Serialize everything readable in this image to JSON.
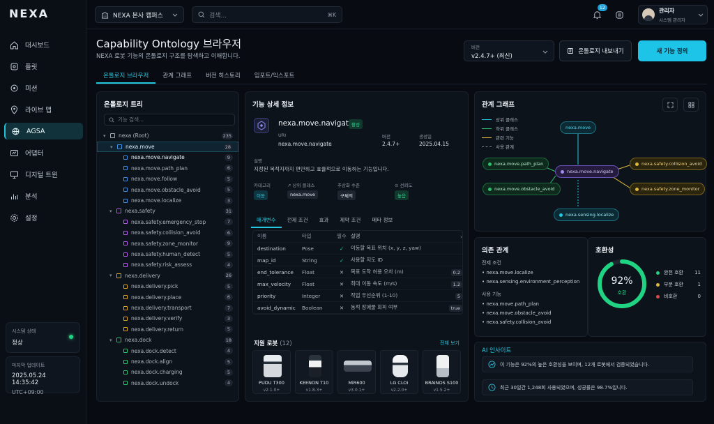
{
  "brand": {
    "logo": "NEXA"
  },
  "sidebar": {
    "items": [
      {
        "label": "대시보드",
        "icon": "home-icon"
      },
      {
        "label": "플릿",
        "icon": "fleet-icon"
      },
      {
        "label": "미션",
        "icon": "mission-icon"
      },
      {
        "label": "라이브 맵",
        "icon": "map-icon"
      },
      {
        "label": "AGSA",
        "icon": "agsa-icon",
        "active": true
      },
      {
        "label": "어댑터",
        "icon": "adapter-icon"
      },
      {
        "label": "디지털 트윈",
        "icon": "twin-icon"
      },
      {
        "label": "분석",
        "icon": "analytics-icon"
      },
      {
        "label": "설정",
        "icon": "settings-icon"
      }
    ],
    "system_status_label": "시스템 상태",
    "system_status_value": "정상",
    "last_update_label": "마지막 업데이트",
    "last_update_value": "2025.05.24 14:35:42",
    "timezone": "UTC+09:00"
  },
  "topbar": {
    "campus": "NEXA 본사 캠퍼스",
    "search_placeholder": "검색...",
    "search_shortcut": "⌘K",
    "notifications_count": "12",
    "user_name": "관리자",
    "user_role": "시스템 관리자"
  },
  "page": {
    "title": "Capability Ontology 브라우저",
    "subtitle": "NEXA 로봇 기능의 온톨로지 구조를 탐색하고 이해합니다.",
    "version_label": "버전",
    "version_value": "v2.4.7+ (최신)",
    "export_label": "온톨로지 내보내기",
    "new_label": "새 기능 정의",
    "tabs": [
      "온톨로지 브라우저",
      "관계 그래프",
      "버전 히스토리",
      "임포트/익스포트"
    ]
  },
  "tree": {
    "title": "온톨로지 트리",
    "search_placeholder": "기능 검색...",
    "root": {
      "label": "nexa (Root)",
      "count": "235"
    },
    "groups": [
      {
        "label": "nexa.move",
        "count": "28",
        "color": "#3b8fe6",
        "children": [
          {
            "label": "nexa.move.navigate",
            "count": "9"
          },
          {
            "label": "nexa.move.path_plan",
            "count": "6"
          },
          {
            "label": "nexa.move.follow",
            "count": "5"
          },
          {
            "label": "nexa.move.obstacle_avoid",
            "count": "5"
          },
          {
            "label": "nexa.move.localize",
            "count": "3"
          }
        ]
      },
      {
        "label": "nexa.safety",
        "count": "31",
        "color": "#b05ce6",
        "children": [
          {
            "label": "nexa.safety.emergency_stop",
            "count": "7"
          },
          {
            "label": "nexa.safety.collision_avoid",
            "count": "6"
          },
          {
            "label": "nexa.safety.zone_monitor",
            "count": "9"
          },
          {
            "label": "nexa.safety.human_detect",
            "count": "5"
          },
          {
            "label": "nexa.safety.risk_assess",
            "count": "4"
          }
        ]
      },
      {
        "label": "nexa.delivery",
        "count": "26",
        "color": "#e0a52b",
        "children": [
          {
            "label": "nexa.delivery.pick",
            "count": "5"
          },
          {
            "label": "nexa.delivery.place",
            "count": "6"
          },
          {
            "label": "nexa.delivery.transport",
            "count": "7"
          },
          {
            "label": "nexa.delivery.verify",
            "count": "3"
          },
          {
            "label": "nexa.delivery.return",
            "count": "5"
          }
        ]
      },
      {
        "label": "nexa.dock",
        "count": "18",
        "color": "#2fbf6e",
        "children": [
          {
            "label": "nexa.dock.detect",
            "count": "4"
          },
          {
            "label": "nexa.dock.align",
            "count": "5"
          },
          {
            "label": "nexa.dock.charging",
            "count": "5"
          },
          {
            "label": "nexa.dock.undock",
            "count": "4"
          }
        ]
      }
    ]
  },
  "detail": {
    "title": "기능 상세 정보",
    "name": "nexa.move.navigate",
    "status": "활성",
    "uri_label": "URI",
    "uri_value": "nexa.move.navigate",
    "version_label": "버전",
    "version_value": "2.4.7+",
    "created_label": "생성일",
    "created_value": "2025.04.15",
    "desc_label": "설명",
    "desc_value": "지정된 목적지까지 편안하고 효율적으로 이동하는 기능입니다.",
    "category_label": "카테고리",
    "category_value": "이동",
    "parent_label": "↗ 상위 클래스",
    "parent_value": "nexa.move",
    "abstraction_label": "추상화 수준",
    "abstraction_value": "구체적",
    "maturity_label": "⊙ 선뢰도",
    "maturity_value": "높음",
    "subtabs": [
      "매개변수",
      "전제 조건",
      "효과",
      "제약 조건",
      "메타 정보"
    ],
    "param_headers": [
      "이름",
      "타입",
      "필수",
      "설명",
      "›"
    ],
    "params": [
      {
        "name": "destination",
        "type": "Pose",
        "req": "✓",
        "desc": "이동할 목표 위치 (x, y, z, yaw)",
        "def": ""
      },
      {
        "name": "map_id",
        "type": "String",
        "req": "✓",
        "desc": "사용할 지도 ID",
        "def": ""
      },
      {
        "name": "end_tolerance",
        "type": "Float",
        "req": "✕",
        "desc": "목표 도착 허용 오차 (m)",
        "def": "0.2"
      },
      {
        "name": "max_velocity",
        "type": "Float",
        "req": "✕",
        "desc": "최대 이동 속도 (m/s)",
        "def": "1.2"
      },
      {
        "name": "priority",
        "type": "Integer",
        "req": "✕",
        "desc": "작업 우선순위 (1-10)",
        "def": "5"
      },
      {
        "name": "avoid_dynamic",
        "type": "Boolean",
        "req": "✕",
        "desc": "동적 장애물 회피 여부",
        "def": "true"
      }
    ],
    "robots_title": "지원 로봇",
    "robots_count": "(12)",
    "robots_all": "전체 보기",
    "robots": [
      {
        "name": "PUDU T300",
        "ver": "v2.1.0+"
      },
      {
        "name": "KEENON T10",
        "ver": "v1.8.3+"
      },
      {
        "name": "MiR600",
        "ver": "v3.0.1+"
      },
      {
        "name": "LG CLOi",
        "ver": "v2.2.0+"
      },
      {
        "name": "BRAINOS S100",
        "ver": "v1.5.2+"
      }
    ]
  },
  "graph": {
    "title": "관계 그래프",
    "legend": [
      "상위 클래스",
      "하위 클래스",
      "관련 기능",
      "사용 관계"
    ],
    "nodes": {
      "parent": "nexa.move",
      "center": "nexa.move.navigate",
      "left1": "nexa.move.path_plan",
      "left2": "nexa.move.obstacle_avoid",
      "right1": "nexa.safety.collision_avoid",
      "right2": "nexa.safety.zone_monitor",
      "bottom": "nexa.sensing.localize"
    }
  },
  "deps": {
    "title": "의존 관계",
    "pre_label": "전제 조건",
    "pre_items": [
      "nexa.move.localize",
      "nexa.sensing.environment_perception"
    ],
    "used_label": "사용 기능",
    "used_items": [
      "nexa.move.path_plan",
      "nexa.move.obstacle_avoid",
      "nexa.safety.collision_avoid"
    ]
  },
  "compat": {
    "title": "호환성",
    "percent": "92%",
    "sub": "호환",
    "ratio": 0.92,
    "rows": [
      {
        "label": "완전 호환",
        "value": "11",
        "color": "#1fd383"
      },
      {
        "label": "부분 호환",
        "value": "1",
        "color": "#e0b83a"
      },
      {
        "label": "비호환",
        "value": "0",
        "color": "#e04848"
      }
    ]
  },
  "insight": {
    "title": "AI 인사이트",
    "items": [
      "이 기능은 92%의 높은 호환성을 보이며, 12개 로봇에서 검증되었습니다.",
      "최근 30일간 1,248회 사용되었으며, 성공률은 98.7%입니다."
    ]
  }
}
